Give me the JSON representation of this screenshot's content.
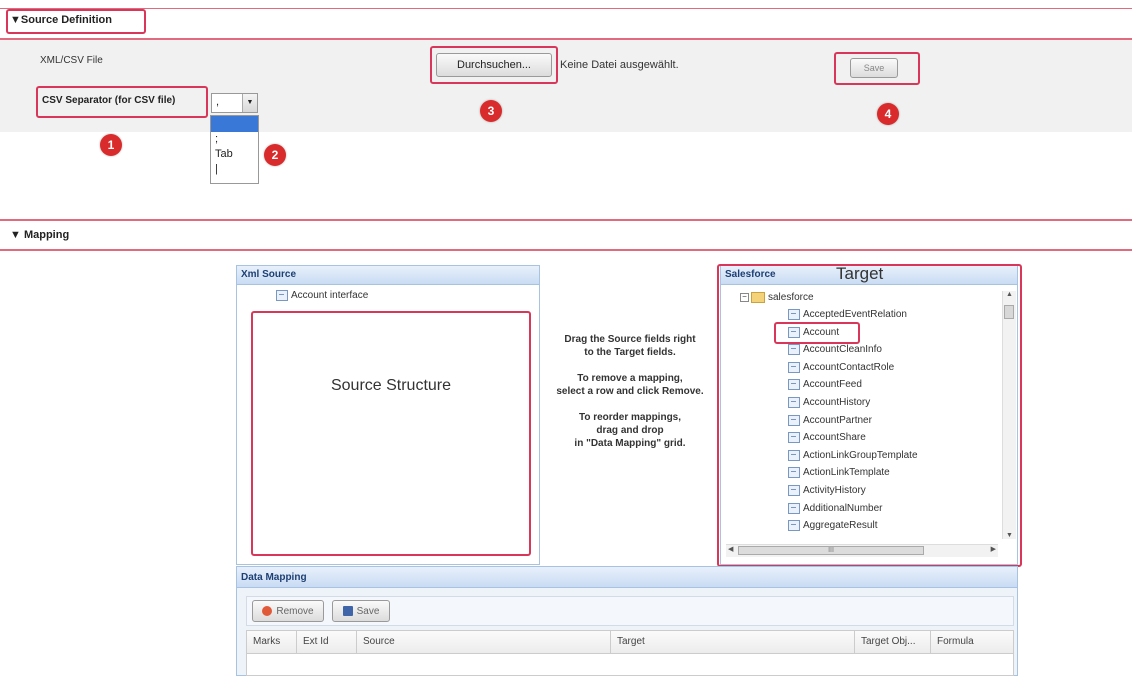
{
  "source_definition": {
    "title": "Source Definition",
    "xml_csv_label": "XML/CSV File",
    "separator_label": "CSV Separator (for CSV file)",
    "separator_value": ",",
    "separator_options": [
      ";",
      "Tab",
      "|"
    ],
    "browse_label": "Durchsuchen...",
    "no_file_text": "Keine Datei ausgewählt.",
    "save_label": "Save"
  },
  "markers": [
    "1",
    "2",
    "3",
    "4"
  ],
  "mapping": {
    "title": "Mapping",
    "xml_source": {
      "header": "Xml Source",
      "root_item": "Account interface",
      "annotation": "Source Structure"
    },
    "instructions": {
      "p1_line1": "Drag the Source fields right",
      "p1_line2": "to the Target fields.",
      "p2_line1": "To remove a mapping,",
      "p2_line2": "select a row and click Remove.",
      "p3_line1": "To reorder mappings,",
      "p3_line2": "drag and drop",
      "p3_line3": "in \"Data Mapping\" grid."
    },
    "salesforce": {
      "header": "Salesforce",
      "annotation": "Target",
      "root": "salesforce",
      "items": [
        "AcceptedEventRelation",
        "Account",
        "AccountCleanInfo",
        "AccountContactRole",
        "AccountFeed",
        "AccountHistory",
        "AccountPartner",
        "AccountShare",
        "ActionLinkGroupTemplate",
        "ActionLinkTemplate",
        "ActivityHistory",
        "AdditionalNumber",
        "AggregateResult"
      ],
      "hscroll_label": "III"
    },
    "data_mapping": {
      "header": "Data Mapping",
      "remove_label": "Remove",
      "save_label": "Save",
      "columns": [
        "Marks",
        "Ext Id",
        "Source",
        "Target",
        "Target Obj...",
        "Formula"
      ]
    }
  },
  "colors": {
    "accent_red": "#d9375a",
    "marker_red": "#d92b2b",
    "panel_blue": "#c9dcf3"
  }
}
